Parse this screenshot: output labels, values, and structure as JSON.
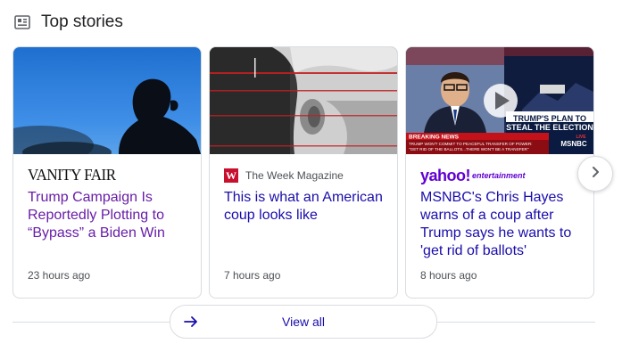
{
  "section": {
    "title": "Top stories",
    "icon": "news-icon"
  },
  "cards": [
    {
      "source": "VANITY FAIR",
      "headline": "Trump Campaign Is Reportedly Plotting to “Bypass” a Biden Win",
      "time": "23 hours ago",
      "visited": true
    },
    {
      "source_logo": "W",
      "source": "The Week Magazine",
      "headline": "This is what an American coup looks like",
      "time": "7 hours ago",
      "visited": false
    },
    {
      "source": "yahoo!",
      "source_sub": "entertainment",
      "headline": "MSNBC's Chris Hayes warns of a coup after Trump says he wants to 'get rid of ballots'",
      "time": "8 hours ago",
      "visited": false,
      "thumb": {
        "banner": "TRUMP'S PLAN TO STEAL THE ELECTION",
        "breaking": "BREAKING NEWS",
        "ticker1": "TRUMP WON'T COMMIT TO PEACEFUL TRANSFER OF POWER:",
        "ticker2": "\"GET RID OF THE BALLOTS...THERE WON'T BE A TRANSFER\"",
        "network": "MSNBC",
        "live": "LIVE"
      }
    }
  ],
  "view_all": "View all",
  "colors": {
    "link": "#1a0dab",
    "visited": "#681da8",
    "border": "#dadce0",
    "yahoo": "#6001d2",
    "week": "#c8102e"
  }
}
